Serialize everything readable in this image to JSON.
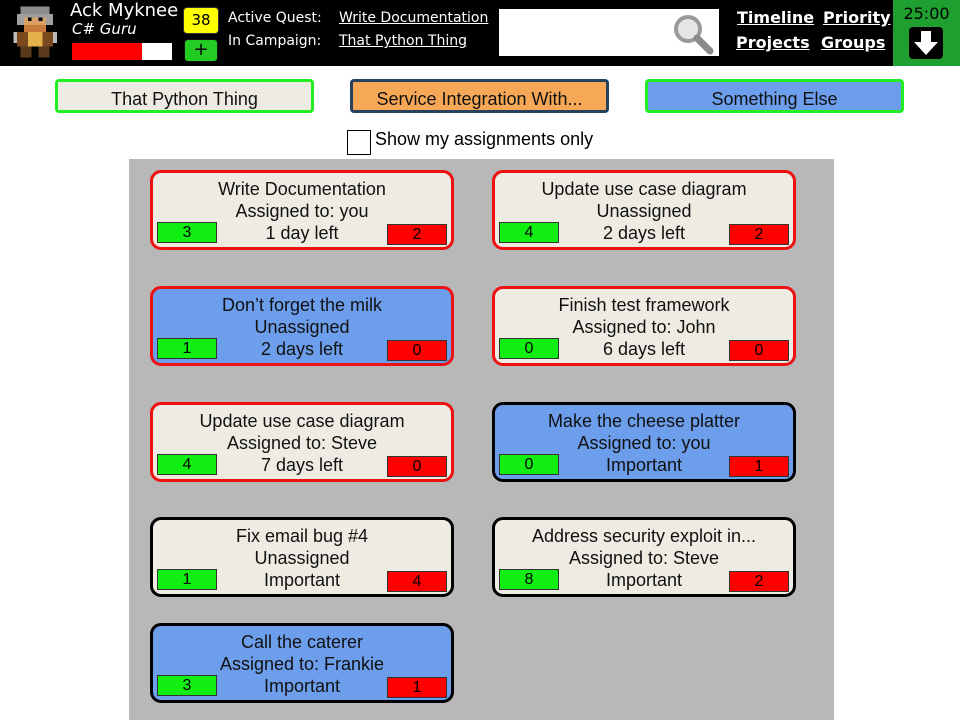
{
  "header": {
    "player_name": "Ack Myknee",
    "player_class": "C# Guru",
    "level": "38",
    "add_label": "+",
    "hp_fraction": 0.7,
    "active_quest_label": "Active Quest:",
    "active_quest_value": "Write Documentation",
    "campaign_label": "In Campaign:",
    "campaign_value": "That Python Thing",
    "search_value": "",
    "nav": {
      "timeline": "Timeline",
      "priority": "Priority",
      "projects": "Projects",
      "groups": "Groups"
    },
    "timer": "25:00"
  },
  "campaign_tabs": [
    {
      "label": "That Python Thing",
      "bg": "#eeebe3",
      "border": "#22ee22"
    },
    {
      "label": "Service Integration With...",
      "bg": "#f7a857",
      "border": "#25415e"
    },
    {
      "label": "Something Else",
      "bg": "#6d9eeb",
      "border": "#22ee22"
    }
  ],
  "filter": {
    "label": "Show my assignments only",
    "checked": false
  },
  "cards": [
    {
      "title": "Write Documentation",
      "line2": "Assigned to: you",
      "line3": "1 day left",
      "green": "3",
      "red": "2",
      "bg": "#eeebe3",
      "border": "#ee1111"
    },
    {
      "title": "Update use case diagram",
      "line2": "Unassigned",
      "line3": "2 days left",
      "green": "4",
      "red": "2",
      "bg": "#eeebe3",
      "border": "#ee1111"
    },
    {
      "title": "Don’t forget the milk",
      "line2": "Unassigned",
      "line3": "2 days left",
      "green": "1",
      "red": "0",
      "bg": "#6d9eeb",
      "border": "#ee1111"
    },
    {
      "title": "Finish test framework",
      "line2": "Assigned to: John",
      "line3": "6 days left",
      "green": "0",
      "red": "0",
      "bg": "#eeebe3",
      "border": "#ee1111"
    },
    {
      "title": "Update use case diagram",
      "line2": "Assigned to: Steve",
      "line3": "7 days left",
      "green": "4",
      "red": "0",
      "bg": "#eeebe3",
      "border": "#ee1111"
    },
    {
      "title": "Make the cheese platter",
      "line2": "Assigned to: you",
      "line3": "Important",
      "green": "0",
      "red": "1",
      "bg": "#6d9eeb",
      "border": "#000000"
    },
    {
      "title": "Fix email bug #4",
      "line2": "Unassigned",
      "line3": "Important",
      "green": "1",
      "red": "4",
      "bg": "#eeebe3",
      "border": "#000000"
    },
    {
      "title": "Address security exploit in...",
      "line2": "Assigned to: Steve",
      "line3": "Important",
      "green": "8",
      "red": "2",
      "bg": "#eeebe3",
      "border": "#000000"
    },
    {
      "title": "Call the caterer",
      "line2": "Assigned to: Frankie",
      "line3": "Important",
      "green": "3",
      "red": "1",
      "bg": "#6d9eeb",
      "border": "#000000"
    }
  ],
  "icons": {
    "search": "magnifier-icon",
    "timer_action": "down-arrow-icon",
    "avatar": "pixel-warrior-avatar"
  }
}
